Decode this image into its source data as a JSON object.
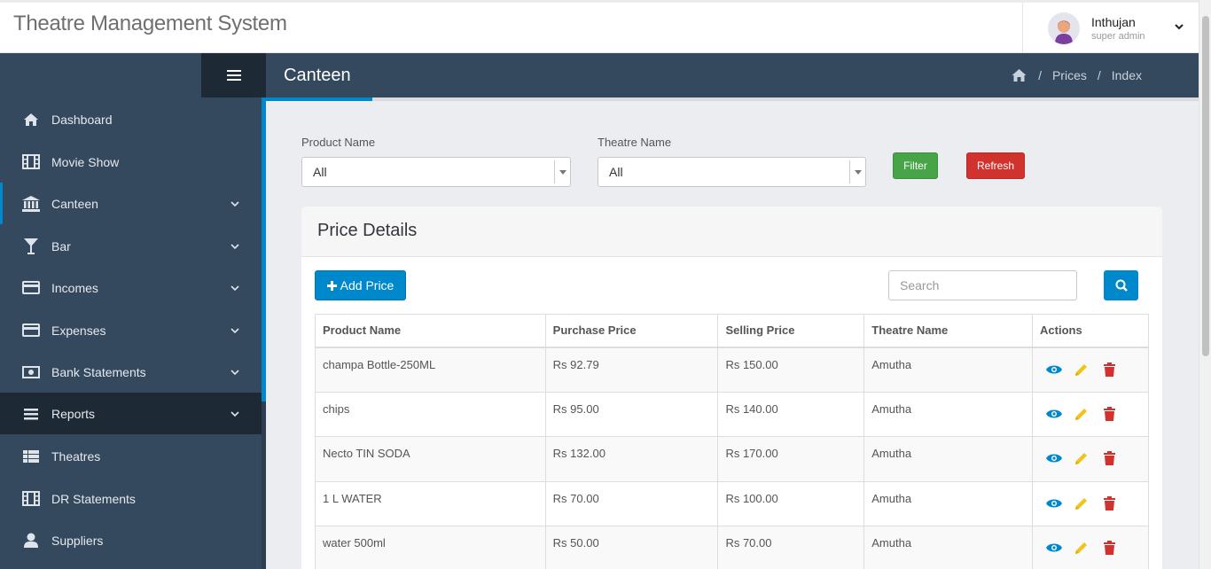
{
  "app": {
    "title": "Theatre Management System"
  },
  "user": {
    "name": "Inthujan",
    "role": "super admin"
  },
  "sidebar": {
    "items": [
      {
        "label": "Dashboard",
        "icon": "home-icon"
      },
      {
        "label": "Movie Show",
        "icon": "film-icon"
      },
      {
        "label": "Canteen",
        "icon": "bank-icon",
        "expandable": true,
        "active": true
      },
      {
        "label": "Bar",
        "icon": "glass-icon",
        "expandable": true
      },
      {
        "label": "Incomes",
        "icon": "credit-card-icon",
        "expandable": true
      },
      {
        "label": "Expenses",
        "icon": "credit-card-icon",
        "expandable": true
      },
      {
        "label": "Bank Statements",
        "icon": "money-icon",
        "expandable": true
      },
      {
        "label": "Reports",
        "icon": "list-icon",
        "expandable": true,
        "highlighted": true
      },
      {
        "label": "Theatres",
        "icon": "table-list-icon"
      },
      {
        "label": "DR Statements",
        "icon": "film-icon"
      },
      {
        "label": "Suppliers",
        "icon": "user-icon"
      }
    ]
  },
  "header": {
    "title": "Canteen",
    "breadcrumb": [
      "Prices",
      "Index"
    ]
  },
  "filters": {
    "product_label": "Product Name",
    "product_value": "All",
    "theatre_label": "Theatre Name",
    "theatre_value": "All",
    "filter_label": "Filter",
    "refresh_label": "Refresh"
  },
  "panel": {
    "title": "Price Details",
    "add_label": "Add Price",
    "search_placeholder": "Search"
  },
  "table": {
    "columns": [
      "Product Name",
      "Purchase Price",
      "Selling Price",
      "Theatre Name",
      "Actions"
    ],
    "rows": [
      [
        "champa Bottle-250ML",
        "Rs 92.79",
        "Rs 150.00",
        "Amutha"
      ],
      [
        "chips",
        "Rs 95.00",
        "Rs 140.00",
        "Amutha"
      ],
      [
        "Necto TIN SODA",
        "Rs 132.00",
        "Rs 170.00",
        "Amutha"
      ],
      [
        "1 L WATER",
        "Rs 70.00",
        "Rs 100.00",
        "Amutha"
      ],
      [
        "water 500ml",
        "Rs 50.00",
        "Rs 70.00",
        "Amutha"
      ]
    ]
  },
  "colors": {
    "sidebar": "#34495e",
    "accent": "#0088cc",
    "filter": "#47a447",
    "refresh": "#d2322d",
    "view_icon": "#0088cc",
    "edit_icon": "#f0ad4e",
    "delete_icon": "#d2322d"
  }
}
